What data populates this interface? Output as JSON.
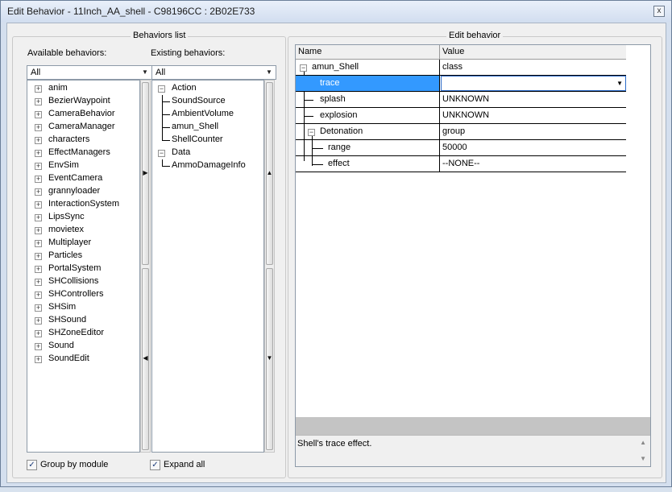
{
  "window": {
    "title": "Edit Behavior - 11Inch_AA_shell - C98196CC : 2B02E733",
    "close_glyph": "x"
  },
  "behaviors_list": {
    "group_title": "Behaviors list",
    "available": {
      "label": "Available behaviors:",
      "filter": "All",
      "items": [
        "anim",
        "BezierWaypoint",
        "CameraBehavior",
        "CameraManager",
        "characters",
        "EffectManagers",
        "EnvSim",
        "EventCamera",
        "grannyloader",
        "InteractionSystem",
        "LipsSync",
        "movietex",
        "Multiplayer",
        "Particles",
        "PortalSystem",
        "SHCollisions",
        "SHControllers",
        "SHSim",
        "SHSound",
        "SHZoneEditor",
        "Sound",
        "SoundEdit"
      ]
    },
    "existing": {
      "label": "Existing behaviors:",
      "filter": "All",
      "groups": [
        {
          "name": "Action",
          "children": [
            "SoundSource",
            "AmbientVolume",
            "amun_Shell",
            "ShellCounter"
          ]
        },
        {
          "name": "Data",
          "children": [
            "AmmoDamageInfo"
          ]
        }
      ]
    },
    "group_by_module": "Group by module",
    "expand_all": "Expand all"
  },
  "edit_behavior": {
    "group_title": "Edit behavior",
    "columns": [
      "Name",
      "Value"
    ],
    "rows": [
      {
        "name": "amun_Shell",
        "value": "class"
      },
      {
        "name": "trace",
        "value": ""
      },
      {
        "name": "splash",
        "value": "UNKNOWN"
      },
      {
        "name": "explosion",
        "value": "UNKNOWN"
      },
      {
        "name": "Detonation",
        "value": "group"
      },
      {
        "name": "range",
        "value": "50000"
      },
      {
        "name": "effect",
        "value": "--NONE--"
      }
    ],
    "description": "Shell's trace effect."
  }
}
